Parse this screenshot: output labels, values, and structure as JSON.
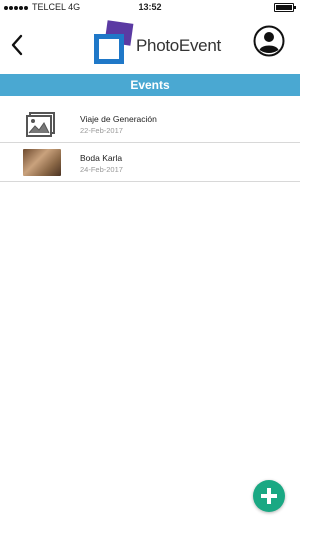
{
  "status": {
    "carrier": "TELCEL 4G",
    "time": "13:52",
    "battery_level": 1.0
  },
  "header": {
    "app_name": "PhotoEvent",
    "back_icon": "chevron-left-icon",
    "profile_icon": "user-profile-icon"
  },
  "section": {
    "title": "Events"
  },
  "events": [
    {
      "title": "Viaje de Generación",
      "date": "22-Feb-2017",
      "thumb": "image-placeholder-icon"
    },
    {
      "title": "Boda Karla",
      "date": "24-Feb-2017",
      "thumb": "event-photo"
    }
  ],
  "fab": {
    "icon": "plus-icon"
  },
  "colors": {
    "accent": "#4aa8d2",
    "fab": "#1aa883"
  }
}
